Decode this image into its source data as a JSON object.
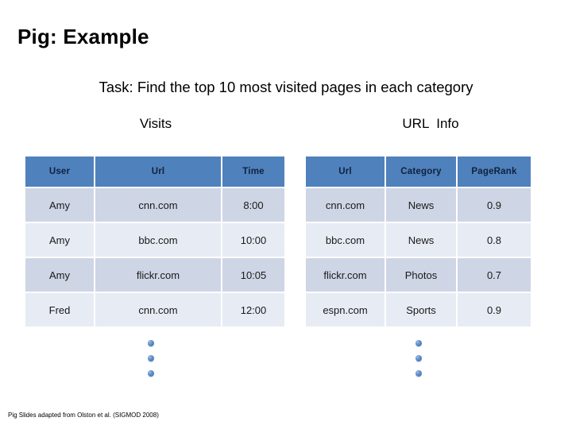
{
  "slide": {
    "title": "Pig: Example",
    "task": "Task: Find the top 10 most visited pages in each category",
    "footnote": "Pig Slides adapted from Olston et al. (SIGMOD 2008)"
  },
  "captions": {
    "visits": "Visits",
    "url_info": "URL  Info"
  },
  "tables": {
    "visits": {
      "name": "Visits",
      "columns": [
        "User",
        "Url",
        "Time"
      ],
      "rows": [
        [
          "Amy",
          "cnn.com",
          "8:00"
        ],
        [
          "Amy",
          "bbc.com",
          "10:00"
        ],
        [
          "Amy",
          "flickr.com",
          "10:05"
        ],
        [
          "Fred",
          "cnn.com",
          "12:00"
        ]
      ]
    },
    "url_info": {
      "name": "URL Info",
      "columns": [
        "Url",
        "Category",
        "PageRank"
      ],
      "rows": [
        [
          "cnn.com",
          "News",
          "0.9"
        ],
        [
          "bbc.com",
          "News",
          "0.8"
        ],
        [
          "flickr.com",
          "Photos",
          "0.7"
        ],
        [
          "espn.com",
          "Sports",
          "0.9"
        ]
      ]
    }
  },
  "ellipsis": {
    "glyph": "vertical-ellipsis",
    "count": 3
  },
  "colors": {
    "header_blue": "#4F81BD",
    "row_dark": "#CED5E5",
    "row_light": "#E7EBF4",
    "dot_blue": "#5B8CC8",
    "text": "#000000"
  }
}
